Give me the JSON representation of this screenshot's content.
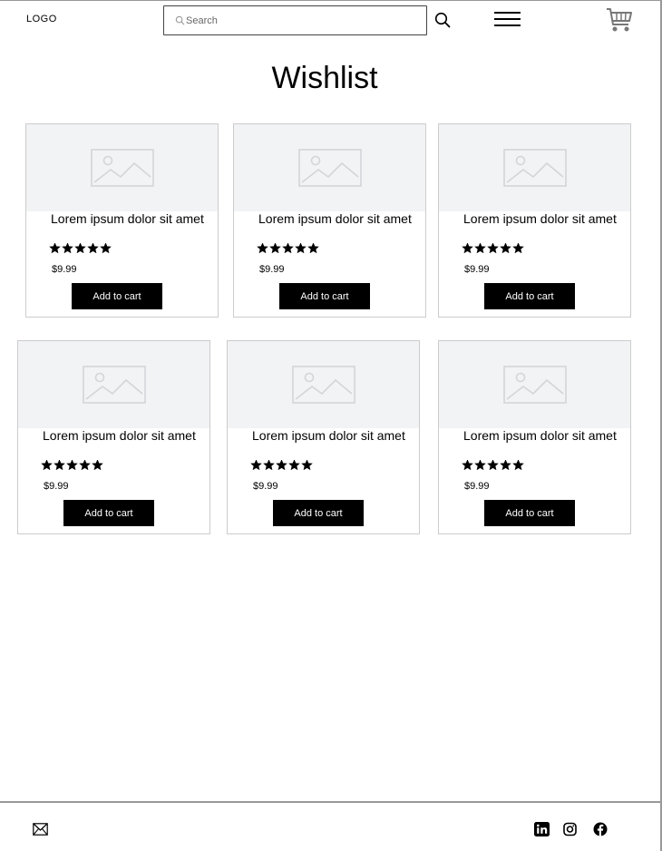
{
  "header": {
    "logo": "LOGO",
    "search_placeholder": "Search"
  },
  "page": {
    "title": "Wishlist"
  },
  "products": [
    {
      "title": "Lorem ipsum dolor sit amet",
      "price": "$9.99",
      "rating": 5,
      "button": "Add to cart"
    },
    {
      "title": "Lorem ipsum dolor sit amet",
      "price": "$9.99",
      "rating": 5,
      "button": "Add to cart"
    },
    {
      "title": "Lorem ipsum dolor sit amet",
      "price": "$9.99",
      "rating": 5,
      "button": "Add to cart"
    },
    {
      "title": "Lorem ipsum dolor sit amet",
      "price": "$9.99",
      "rating": 5,
      "button": "Add to cart"
    },
    {
      "title": "Lorem ipsum dolor sit amet",
      "price": "$9.99",
      "rating": 5,
      "button": "Add to cart"
    },
    {
      "title": "Lorem ipsum dolor sit amet",
      "price": "$9.99",
      "rating": 5,
      "button": "Add to cart"
    }
  ],
  "footer": {
    "icons": [
      "mail-icon",
      "linkedin-icon",
      "instagram-icon",
      "facebook-icon"
    ]
  }
}
